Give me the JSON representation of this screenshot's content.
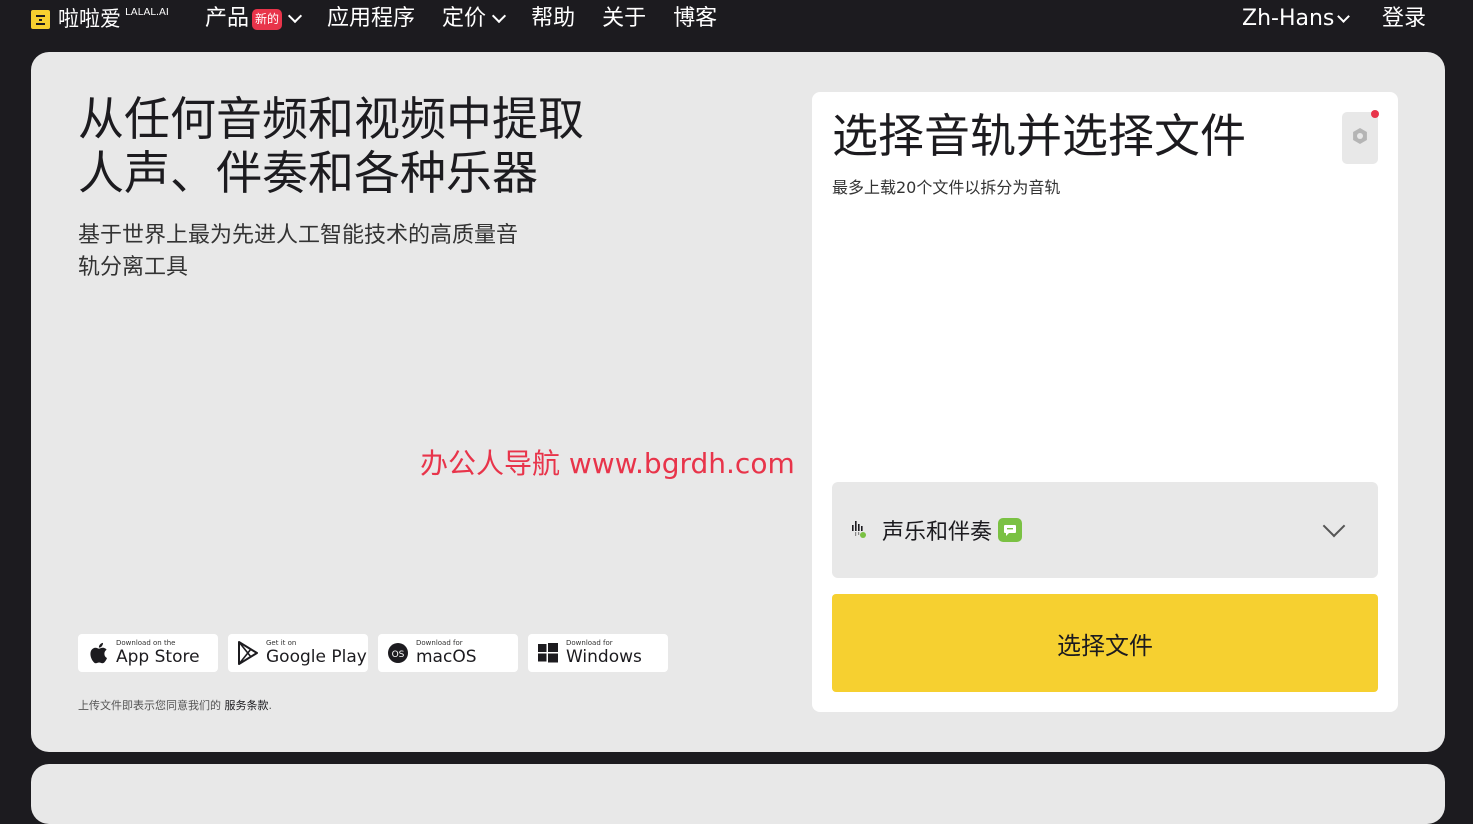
{
  "nav": {
    "logo_text": "啦啦爱",
    "logo_sup": "LALAL.AI",
    "items": [
      {
        "label": "产品",
        "badge": "新的",
        "has_dropdown": true
      },
      {
        "label": "应用程序",
        "has_dropdown": false
      },
      {
        "label": "定价",
        "has_dropdown": true
      },
      {
        "label": "帮助",
        "has_dropdown": false
      },
      {
        "label": "关于",
        "has_dropdown": false
      },
      {
        "label": "博客",
        "has_dropdown": false
      }
    ],
    "language": "Zh-Hans",
    "login": "登录"
  },
  "hero": {
    "title_line1": "从任何音频和视频中提取",
    "title_line2": "人声、伴奏和各种乐器",
    "subtitle_line1": "基于世界上最为先进人工智能技术的高质量音",
    "subtitle_line2": "轨分离工具"
  },
  "stores": [
    {
      "small": "Download on the",
      "big": "App Store",
      "icon": "apple-icon"
    },
    {
      "small": "Get it on",
      "big": "Google Play",
      "icon": "google-play-icon"
    },
    {
      "small": "Download for",
      "big": "macOS",
      "icon": "macos-icon"
    },
    {
      "small": "Download for",
      "big": "Windows",
      "icon": "windows-icon"
    }
  ],
  "terms": {
    "prefix": "上传文件即表示您同意我们的",
    "link": "服务条款",
    "suffix": "."
  },
  "panel": {
    "title": "选择音轨并选择文件",
    "subtitle": "最多上载20个文件以拆分为音轨",
    "stem_select": "声乐和伴奏",
    "choose_button": "选择文件"
  },
  "watermark": "办公人导航 www.bgrdh.com",
  "colors": {
    "background": "#1c1b1f",
    "card": "#e8e8e8",
    "accent_yellow": "#f6d030",
    "badge_red": "#e8344a",
    "ai_green": "#7ac143"
  }
}
